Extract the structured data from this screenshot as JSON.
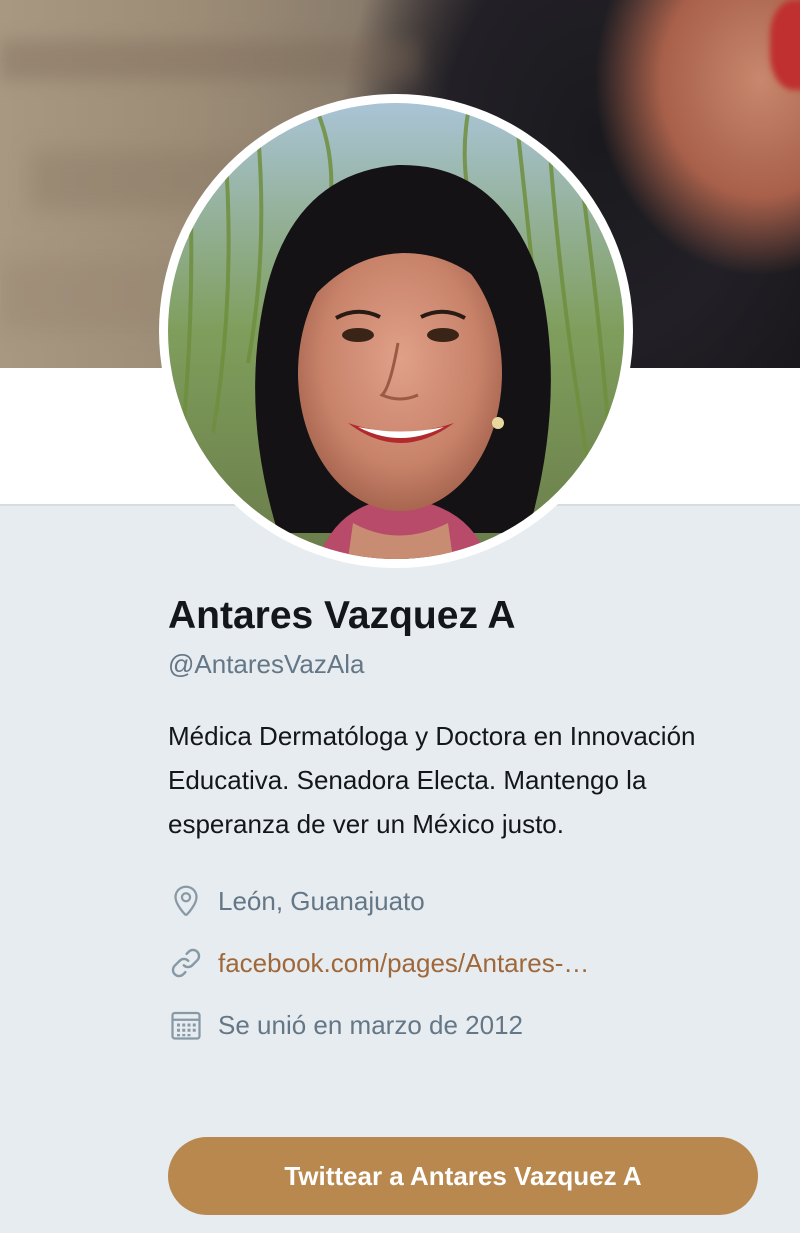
{
  "profile": {
    "name": "Antares Vazquez A",
    "handle": "@AntaresVazAla",
    "bio": "Médica Dermatóloga y Doctora en Innovación Educativa. Senadora Electa. Mantengo la esperanza de ver un México justo.",
    "location": "León, Guanajuato",
    "website": "facebook.com/pages/Antares-…",
    "joined": "Se unió en marzo de 2012"
  },
  "actions": {
    "tweet_to_label": "Twittear a Antares Vazquez A"
  },
  "icons": {
    "location": "map-pin-icon",
    "website": "link-icon",
    "joined": "calendar-icon"
  },
  "colors": {
    "accent": "#b8884e",
    "link": "#a0683a",
    "secondary_text": "#657786",
    "primary_text": "#14171a",
    "background": "#e6ecf0"
  }
}
